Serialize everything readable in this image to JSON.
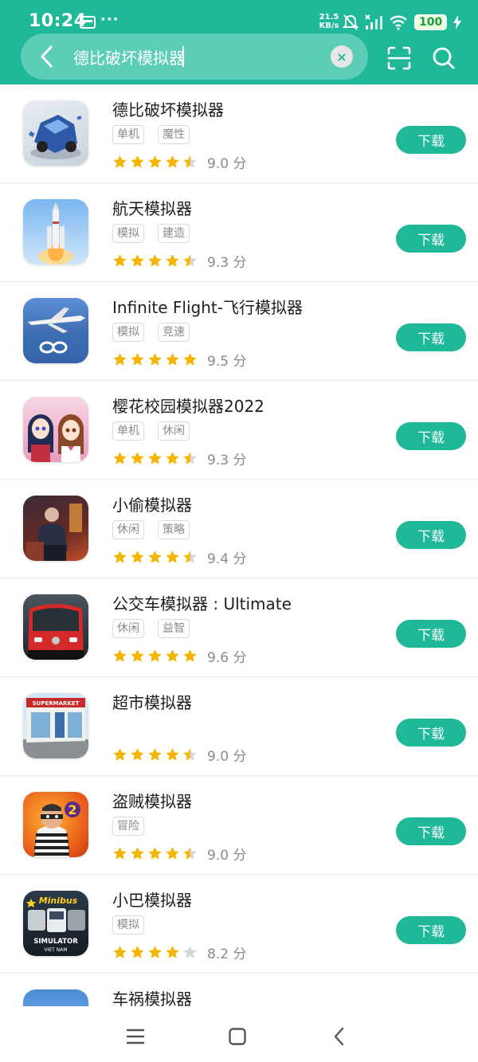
{
  "status_bar": {
    "time": "10:24",
    "more": "···",
    "net_speed_value": "21.5",
    "net_speed_unit": "KB/s",
    "battery": "100"
  },
  "search": {
    "value": "德比破坏模拟器",
    "clear_glyph": "×"
  },
  "colors": {
    "brand": "#1fb99a",
    "star": "#f5b400",
    "star_empty": "#d6d6d6"
  },
  "apps": [
    {
      "name": "德比破坏模拟器",
      "tags": [
        "单机",
        "魔性"
      ],
      "stars": 4.5,
      "score": "9.0 分",
      "button": "下载",
      "icon": "derby-car-icon"
    },
    {
      "name": "航天模拟器",
      "tags": [
        "模拟",
        "建造"
      ],
      "stars": 4.5,
      "score": "9.3 分",
      "button": "下载",
      "icon": "rocket-icon"
    },
    {
      "name": "Infinite Flight-飞行模拟器",
      "tags": [
        "模拟",
        "竞速"
      ],
      "stars": 5,
      "score": "9.5 分",
      "button": "下载",
      "icon": "airplane-icon"
    },
    {
      "name": "樱花校园模拟器2022",
      "tags": [
        "单机",
        "休闲"
      ],
      "stars": 4.5,
      "score": "9.3 分",
      "button": "下载",
      "icon": "anime-girls-icon"
    },
    {
      "name": "小偷模拟器",
      "tags": [
        "休闲",
        "策略"
      ],
      "stars": 4.5,
      "score": "9.4 分",
      "button": "下载",
      "icon": "thief-icon"
    },
    {
      "name": "公交车模拟器 : Ultimate",
      "tags": [
        "休闲",
        "益智"
      ],
      "stars": 5,
      "score": "9.6 分",
      "button": "下载",
      "icon": "bus-icon"
    },
    {
      "name": "超市模拟器",
      "tags": [],
      "stars": 4.5,
      "score": "9.0 分",
      "button": "下载",
      "icon": "supermarket-icon",
      "icon_text": "SUPERMARKET"
    },
    {
      "name": "盗贼模拟器",
      "tags": [
        "冒险"
      ],
      "stars": 4.5,
      "score": "9.0 分",
      "button": "下载",
      "icon": "robber-icon",
      "icon_text": "2"
    },
    {
      "name": "小巴模拟器",
      "tags": [
        "模拟"
      ],
      "stars": 4,
      "score": "8.2 分",
      "button": "下载",
      "icon": "minibus-icon",
      "icon_text": "Minibus",
      "icon_text2": "SIMULATOR",
      "icon_text3": "VIET NAM"
    },
    {
      "name": "车祸模拟器",
      "tags": [],
      "stars": null,
      "score": "",
      "button": "",
      "icon": "crash-icon"
    }
  ]
}
